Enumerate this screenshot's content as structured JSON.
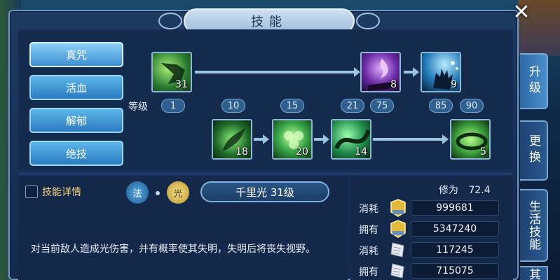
{
  "window": {
    "title": "技能",
    "close_symbol": "✕"
  },
  "left_buttons": [
    {
      "label": "真咒",
      "active": true
    },
    {
      "label": "活血",
      "active": false
    },
    {
      "label": "解郁",
      "active": false
    },
    {
      "label": "绝技",
      "active": false
    }
  ],
  "skill_tree": {
    "row1": [
      {
        "level": "31",
        "icon": "grab-hand-icon",
        "color": "#3fa24a"
      },
      {
        "level": "8",
        "icon": "purple-flame-hand-icon",
        "color": "#7a3fb5"
      },
      {
        "level": "9",
        "icon": "blue-spark-hand-icon",
        "color": "#2a8fc9"
      }
    ],
    "row2": [
      {
        "level": "18",
        "icon": "leaf-swirl-icon",
        "color": "#2e9a3a"
      },
      {
        "level": "20",
        "icon": "green-orbs-icon",
        "color": "#3ab84a"
      },
      {
        "level": "14",
        "icon": "green-wave-icon",
        "color": "#2ea05a"
      },
      {
        "level": "5",
        "icon": "green-vortex-icon",
        "color": "#44b04a"
      }
    ],
    "level_label": "等级",
    "level_marks": [
      "1",
      "10",
      "15",
      "21",
      "75",
      "85",
      "90"
    ]
  },
  "detail": {
    "checkbox_label": "技能详情",
    "badge_fa": "法",
    "badge_guang": "光",
    "skill_name": "千里光 31级",
    "description": "对当前敌人造成光伤害，并有概率使其失明，失明后将丧失视野。"
  },
  "resources": {
    "xiuwei_label": "修为",
    "xiuwei_value": "72.4",
    "rows": [
      {
        "label": "消耗",
        "icon": "gold-exp-icon",
        "value": "999681"
      },
      {
        "label": "拥有",
        "icon": "gold-exp-icon",
        "value": "5347240"
      },
      {
        "label": "消耗",
        "icon": "scroll-icon",
        "value": "117245"
      },
      {
        "label": "拥有",
        "icon": "scroll-icon",
        "value": "715075"
      }
    ]
  },
  "side_tabs": [
    {
      "label": "升级",
      "active": true
    },
    {
      "label": "更换",
      "active": false
    },
    {
      "label": "生活技能",
      "active": false
    },
    {
      "label": "其",
      "active": false
    }
  ],
  "colors": {
    "accent": "#5cb6ea",
    "gold_text": "#f3d27a",
    "panel": "#17305a"
  }
}
